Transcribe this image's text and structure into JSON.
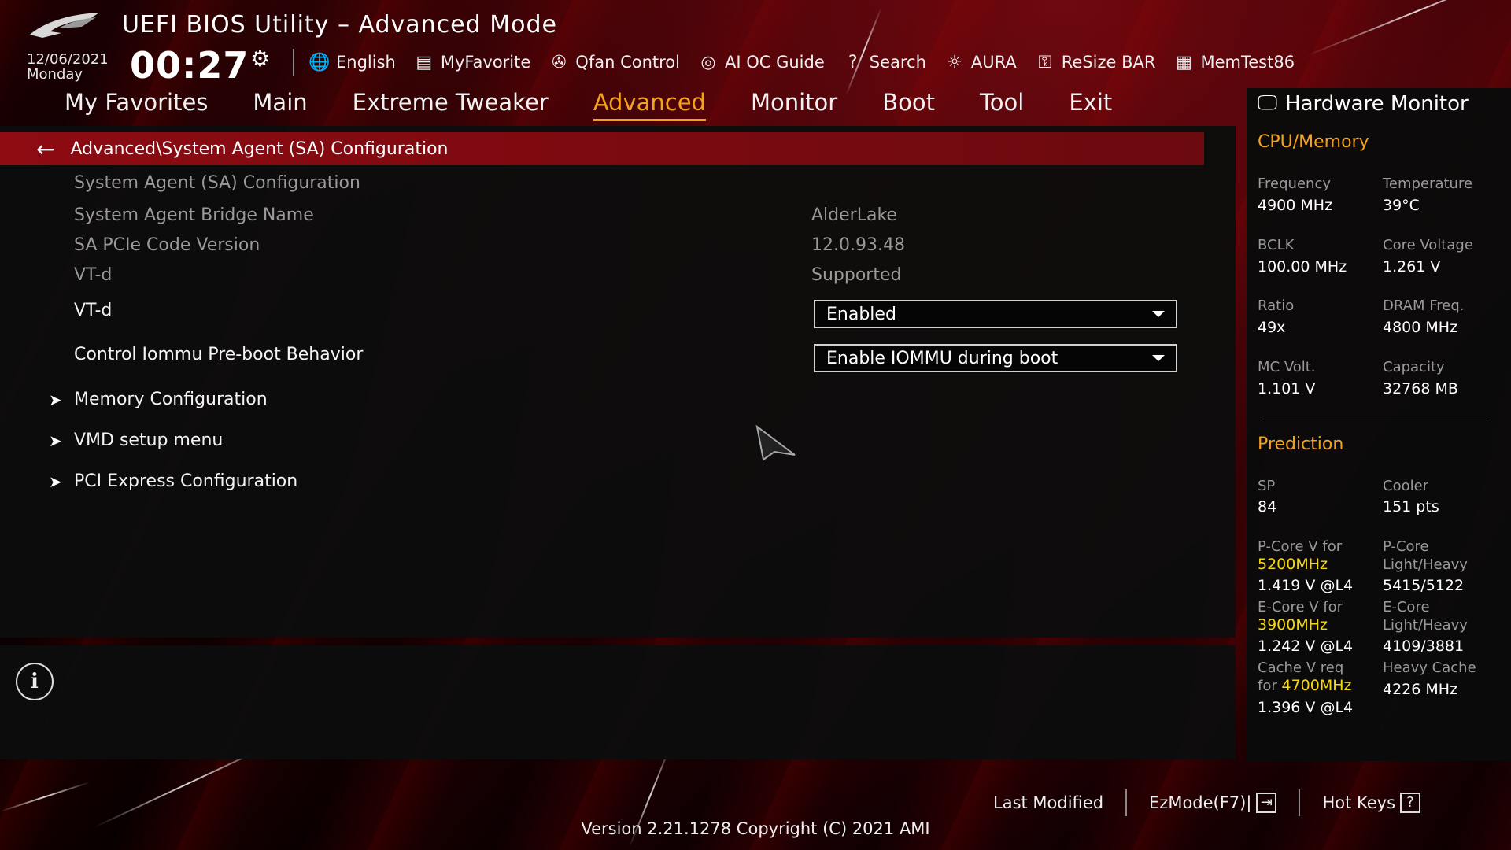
{
  "header": {
    "title": "UEFI BIOS Utility – Advanced Mode",
    "date": "12/06/2021",
    "weekday": "Monday",
    "time": "00:27"
  },
  "toolbar": [
    {
      "icon": "globe-icon",
      "glyph": "🌐",
      "label": "English"
    },
    {
      "icon": "myfavorite-icon",
      "glyph": "▤",
      "label": "MyFavorite"
    },
    {
      "icon": "fan-icon",
      "glyph": "✇",
      "label": "Qfan Control"
    },
    {
      "icon": "ai-oc-icon",
      "glyph": "◎",
      "label": "AI OC Guide"
    },
    {
      "icon": "search-icon",
      "glyph": "?",
      "label": "Search"
    },
    {
      "icon": "aura-icon",
      "glyph": "☼",
      "label": "AURA"
    },
    {
      "icon": "resize-bar-icon",
      "glyph": "⚿",
      "label": "ReSize BAR"
    },
    {
      "icon": "memtest-icon",
      "glyph": "▦",
      "label": "MemTest86"
    }
  ],
  "tabs": [
    "My Favorites",
    "Main",
    "Extreme Tweaker",
    "Advanced",
    "Monitor",
    "Boot",
    "Tool",
    "Exit"
  ],
  "active_tab": "Advanced",
  "colors": {
    "accent": "#f5a21b",
    "highlight": "#f6d80f",
    "breadcrumb": "#8e0b12"
  },
  "main": {
    "breadcrumb": "Advanced\\System Agent (SA) Configuration",
    "section_heading": "System Agent (SA) Configuration",
    "info": [
      {
        "label": "System Agent Bridge Name",
        "value": "AlderLake"
      },
      {
        "label": "SA PCIe Code Version",
        "value": "12.0.93.48"
      },
      {
        "label": "VT-d",
        "value": "Supported"
      }
    ],
    "settings": [
      {
        "label": "VT-d",
        "value": "Enabled"
      },
      {
        "label": "Control Iommu Pre-boot Behavior",
        "value": "Enable IOMMU during boot"
      }
    ],
    "submenus": [
      "Memory Configuration",
      "VMD setup menu",
      "PCI Express Configuration"
    ]
  },
  "hw_monitor": {
    "title": "Hardware Monitor",
    "cpu_memory": {
      "heading": "CPU/Memory",
      "items": [
        {
          "label": "Frequency",
          "value": "4900 MHz"
        },
        {
          "label": "Temperature",
          "value": "39°C"
        },
        {
          "label": "BCLK",
          "value": "100.00 MHz"
        },
        {
          "label": "Core Voltage",
          "value": "1.261 V"
        },
        {
          "label": "Ratio",
          "value": "49x"
        },
        {
          "label": "DRAM Freq.",
          "value": "4800 MHz"
        },
        {
          "label": "MC Volt.",
          "value": "1.101 V"
        },
        {
          "label": "Capacity",
          "value": "32768 MB"
        }
      ]
    },
    "prediction": {
      "heading": "Prediction",
      "sp_label": "SP",
      "sp_value": "84",
      "cooler_label": "Cooler",
      "cooler_value": "151 pts",
      "pcore_v_label": "P-Core V for",
      "pcore_v_freq": "5200MHz",
      "pcore_v_value": "1.419 V @L4",
      "pcore_lh_label1": "P-Core",
      "pcore_lh_label2": "Light/Heavy",
      "pcore_lh_value": "5415/5122",
      "ecore_v_label": "E-Core V for",
      "ecore_v_freq": "3900MHz",
      "ecore_v_value": "1.242 V @L4",
      "ecore_lh_label1": "E-Core",
      "ecore_lh_label2": "Light/Heavy",
      "ecore_lh_value": "4109/3881",
      "cache_v_label1": "Cache V req",
      "cache_v_label2": "for",
      "cache_v_freq": "4700MHz",
      "cache_v_value": "1.396 V @L4",
      "heavy_cache_label": "Heavy Cache",
      "heavy_cache_value": "4226 MHz"
    }
  },
  "footer": {
    "last_modified": "Last Modified",
    "ezmode": "EzMode(F7)|",
    "hotkeys": "Hot Keys",
    "version": "Version 2.21.1278 Copyright (C) 2021 AMI"
  }
}
